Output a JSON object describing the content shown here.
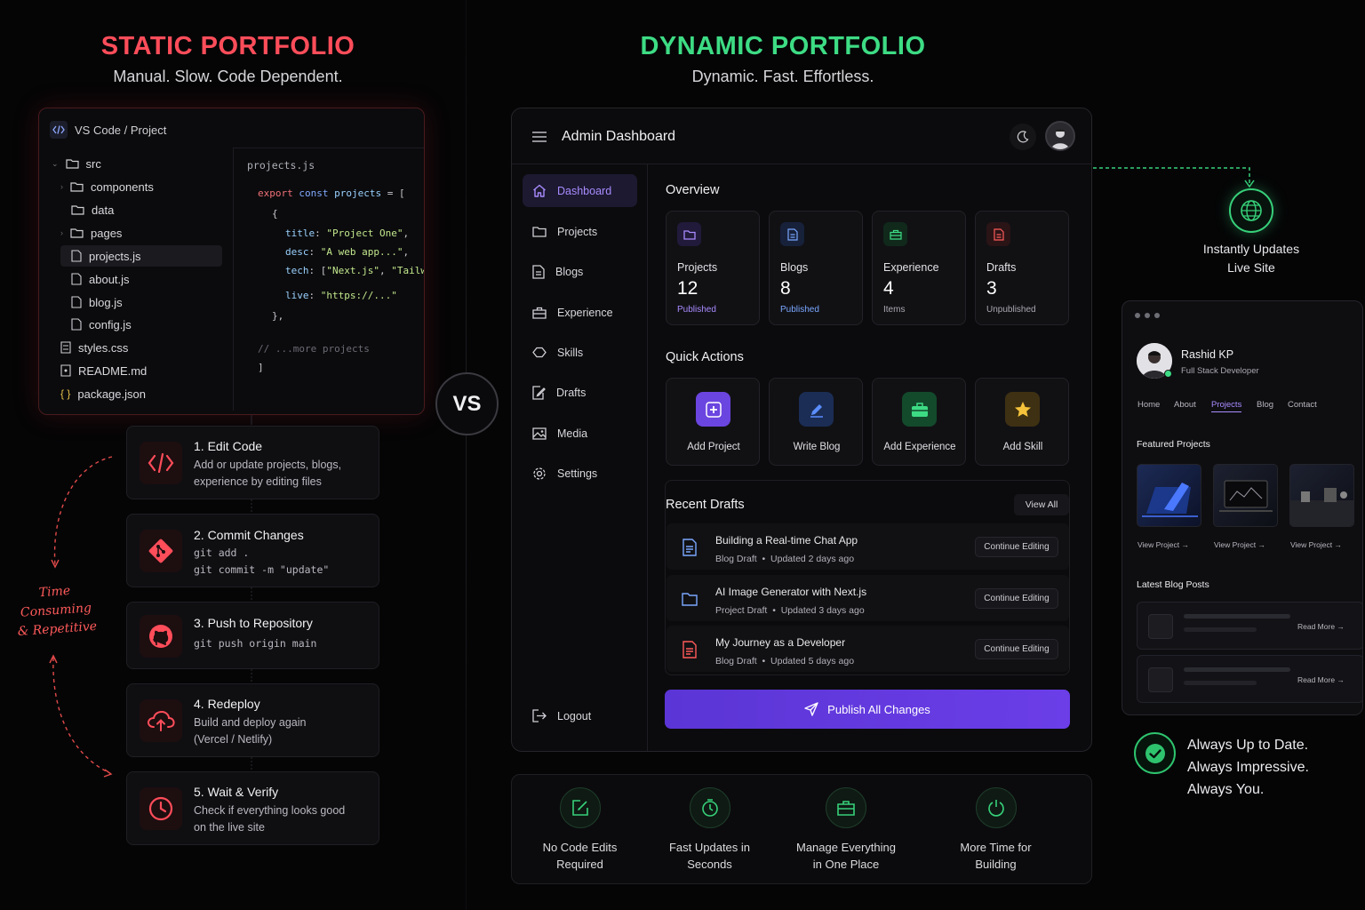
{
  "left": {
    "title": "STATIC PORTFOLIO",
    "subtitle": "Manual. Slow. Code Dependent.",
    "title_color": "#ff4d5a",
    "editor": {
      "title": "VS Code / Project",
      "tree": [
        "src",
        "components",
        "data",
        "pages",
        "projects.js",
        "about.js",
        "blog.js",
        "config.js",
        "styles.css",
        "README.md",
        "package.json"
      ],
      "file_tab": "projects.js",
      "code": {
        "l1a": "export",
        "l1b": "const",
        "l1c": "projects",
        "l1d": " = [",
        "l2": "{",
        "l3k": "title",
        "l3v": "\"Project One\"",
        "l4k": "desc",
        "l4v": "\"A web app...\"",
        "l5k": "tech",
        "l5v1": "\"Next.js\"",
        "l5v2": "\"Tailwind\"",
        "l6k": "live",
        "l6v": "\"https://...\"",
        "l7": "},",
        "l8": "// ...more projects",
        "l9": "]"
      }
    },
    "vs": "VS",
    "steps": [
      {
        "title": "1. Edit Code",
        "desc1": "Add or update projects, blogs,",
        "desc2": "experience by editing files"
      },
      {
        "title": "2. Commit Changes",
        "desc1": "git add .",
        "desc2": "git commit -m \"update\""
      },
      {
        "title": "3. Push to Repository",
        "desc1": "git push origin main"
      },
      {
        "title": "4. Redeploy",
        "desc1": "Build and deploy again",
        "desc2": "(Vercel / Netlify)"
      },
      {
        "title": "5. Wait & Verify",
        "desc1": "Check if everything looks good",
        "desc2": "on the live site"
      }
    ],
    "note": [
      "Time",
      "Consuming",
      "& Repetitive"
    ]
  },
  "right": {
    "title": "DYNAMIC PORTFOLIO",
    "subtitle": "Dynamic. Fast. Effortless.",
    "title_color": "#3ddc84",
    "dashboard": {
      "title": "Admin Dashboard",
      "nav": [
        "Dashboard",
        "Projects",
        "Blogs",
        "Experience",
        "Skills",
        "Drafts",
        "Media",
        "Settings"
      ],
      "logout": "Logout",
      "overview": "Overview",
      "stats": [
        {
          "label": "Projects",
          "value": "12",
          "sub": "Published",
          "color": "#a98bff"
        },
        {
          "label": "Blogs",
          "value": "8",
          "sub": "Published",
          "color": "#7aa7ff"
        },
        {
          "label": "Experience",
          "value": "4",
          "sub": "Items",
          "color": "#3ddc84"
        },
        {
          "label": "Drafts",
          "value": "3",
          "sub": "Unpublished",
          "color": "#ff5a5a"
        }
      ],
      "quick_actions_title": "Quick Actions",
      "quick_actions": [
        "Add Project",
        "Write Blog",
        "Add Experience",
        "Add Skill"
      ],
      "recent_drafts_title": "Recent Drafts",
      "view_all": "View All",
      "drafts": [
        {
          "title": "Building a Real-time Chat App",
          "type": "Blog Draft",
          "updated": "Updated 2 days ago"
        },
        {
          "title": "AI Image Generator with Next.js",
          "type": "Project Draft",
          "updated": "Updated 3 days ago"
        },
        {
          "title": "My Journey as a Developer",
          "type": "Blog Draft",
          "updated": "Updated 5 days ago"
        }
      ],
      "continue": "Continue Editing",
      "publish": "Publish All Changes"
    },
    "benefits": [
      {
        "l1": "No Code Edits",
        "l2": "Required"
      },
      {
        "l1": "Fast Updates in",
        "l2": "Seconds"
      },
      {
        "l1": "Manage Everything",
        "l2": "in One Place"
      },
      {
        "l1": "More Time for",
        "l2": "Building"
      }
    ],
    "live": [
      "Instantly Updates",
      "Live Site"
    ],
    "site": {
      "name": "Rashid KP",
      "role": "Full Stack Developer",
      "nav": [
        "Home",
        "About",
        "Projects",
        "Blog",
        "Contact"
      ],
      "featured": "Featured Projects",
      "view_project": "View Project →",
      "latest": "Latest Blog Posts",
      "read_more": "Read More →"
    },
    "always": [
      "Always Up to Date.",
      "Always Impressive.",
      "Always You."
    ]
  }
}
